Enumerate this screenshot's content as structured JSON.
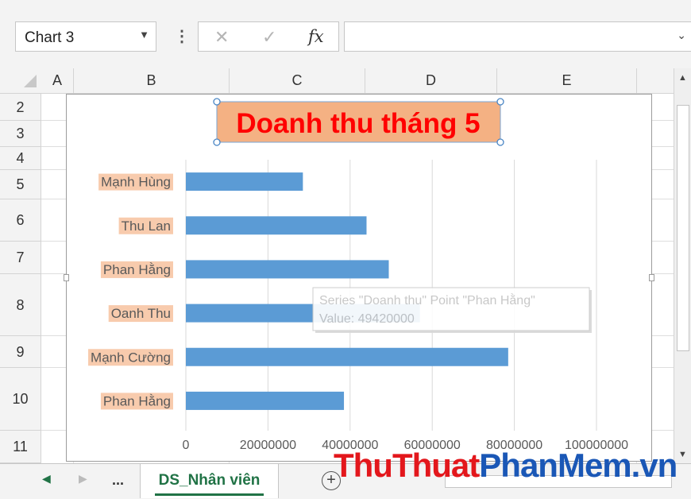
{
  "formula_bar": {
    "name_box": "Chart 3",
    "cancel_symbol": "✕",
    "enter_symbol": "✓",
    "fx_symbol": "fx",
    "formula_value": ""
  },
  "columns": [
    "A",
    "B",
    "C",
    "D",
    "E"
  ],
  "rows": [
    "2",
    "3",
    "4",
    "5",
    "6",
    "7",
    "8",
    "9",
    "10",
    "11"
  ],
  "chart_data": {
    "type": "bar",
    "orientation": "horizontal",
    "title": "Doanh thu tháng 5",
    "categories": [
      "Mạnh Hùng",
      "Thu Lan",
      "Phan Hằng",
      "Oanh Thu",
      "Mạnh Cường",
      "Phan Hằng"
    ],
    "series": [
      {
        "values": [
          28500000,
          44000000,
          49420000,
          57000000,
          78500000,
          38500000
        ],
        "color": "#5b9bd5"
      }
    ],
    "xlim": [
      0,
      100000000
    ],
    "xticks": [
      "0",
      "20000000",
      "40000000",
      "60000000",
      "80000000",
      "100000000"
    ],
    "grid": true,
    "category_label_highlight": "#f8cbad",
    "title_color": "#ff0000",
    "title_fill": "#f4b183",
    "tooltip": {
      "line1": "Series \"Doanh thu\" Point \"Phan Hằng\"",
      "line2": "Value: 49420000"
    }
  },
  "sheet_tabs": {
    "ellipsis": "...",
    "active": "DS_Nhân viên",
    "add_symbol": "+"
  },
  "watermark": {
    "part1": "ThuThuat",
    "part2": "PhanMem.vn"
  }
}
